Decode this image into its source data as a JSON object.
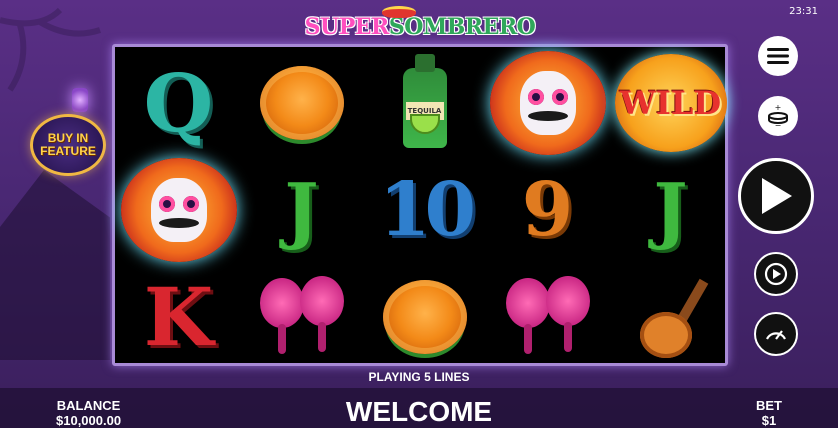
{
  "status_bar": {
    "time": "23:31"
  },
  "game": {
    "logo_part1": "SUPER",
    "logo_part2": "SOMBRERO"
  },
  "buy_feature": {
    "line1": "BUY IN",
    "line2": "FEATURE"
  },
  "reels": [
    [
      "Q",
      "skull",
      "K"
    ],
    [
      "marigold",
      "J",
      "maracas"
    ],
    [
      "tequila",
      "10",
      "marigold"
    ],
    [
      "skull",
      "9",
      "maracas"
    ],
    [
      "wild",
      "J",
      "guitar"
    ]
  ],
  "symbols": {
    "tequila_label": "TEQUILA",
    "wild_label": "WILD"
  },
  "status": {
    "lines_text": "PLAYING 5 LINES",
    "message": "WELCOME"
  },
  "balance": {
    "label": "BALANCE",
    "value": "$10,000.00"
  },
  "bet": {
    "label": "BET",
    "value": "$1"
  },
  "controls": [
    "menu-icon",
    "coin-stack-icon",
    "play-icon",
    "autoplay-icon",
    "turbo-icon"
  ],
  "colors": {
    "frame": "#a88ad6",
    "background": "#4a2874",
    "accent_gold": "#f0b842"
  }
}
